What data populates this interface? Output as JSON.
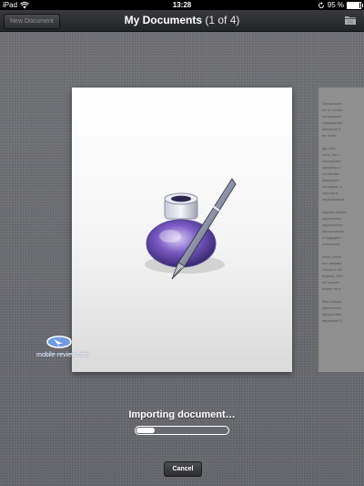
{
  "status_bar": {
    "device": "iPad",
    "time": "13:28",
    "battery": "95 %",
    "battery_level": 0.95
  },
  "nav": {
    "new_document_label": "New Document",
    "title": "My Documents",
    "count": "(1 of 4)",
    "folder_icon": "folder-icon"
  },
  "next_document_lines": [
    "Пользовате",
    "не то чтобы",
    "пользовате",
    "традиционн",
    "MacBook P",
    "не лезет.",
    "",
    "Да, Mac – ",
    "хотя, это н",
    "консультан",
    "офисных к",
    "отечестве",
    "факультет",
    "человеко, в",
    "хороши и",
    "перерабатыв",
    "",
    "Однако зачем",
    "замечатель",
    "управления",
    "рассыпаться",
    "и будущей т",
    "гениальни",
    "",
    "Итак, Steve",
    "мы, каковы",
    "только в об",
    "играми. Пол",
    "не начале",
    "может не р",
    "",
    "Mac конкре",
    "практическ",
    "предоставл",
    "версиями O"
  ],
  "watermark": "mobile-review.com",
  "import": {
    "label": "Importing document…",
    "progress": 0.22
  },
  "cancel_label": "Cancel"
}
